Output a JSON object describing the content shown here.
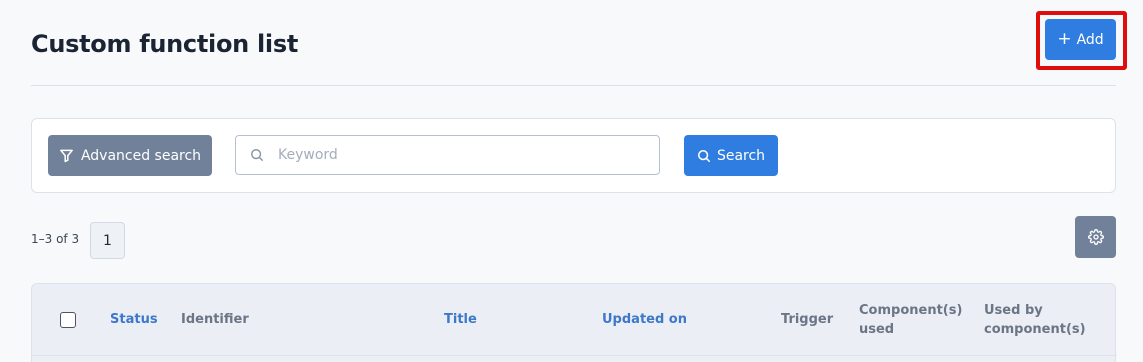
{
  "header": {
    "title": "Custom function list",
    "add_label": "Add"
  },
  "search": {
    "advanced_label": "Advanced search",
    "keyword_placeholder": "Keyword",
    "keyword_value": "",
    "search_label": "Search"
  },
  "pagination": {
    "range_text": "1–3 of 3",
    "current_page": "1"
  },
  "table": {
    "columns": [
      {
        "label": "Status",
        "sortable": true
      },
      {
        "label": "Identifier",
        "sortable": false
      },
      {
        "label": "Title",
        "sortable": true
      },
      {
        "label": "Updated on",
        "sortable": true
      },
      {
        "label": "Trigger",
        "sortable": false
      },
      {
        "label": "Component(s) used",
        "sortable": false
      },
      {
        "label": "Used by component(s)",
        "sortable": false
      }
    ]
  },
  "icons": {
    "add": "plus-icon",
    "advanced": "filter-icon",
    "keyword": "search-icon",
    "search": "search-icon",
    "settings": "gear-icon"
  },
  "colors": {
    "primary": "#2f7de1",
    "secondary": "#71819a",
    "highlight": "#e00d0d",
    "sortable_header": "#3d78c9"
  }
}
